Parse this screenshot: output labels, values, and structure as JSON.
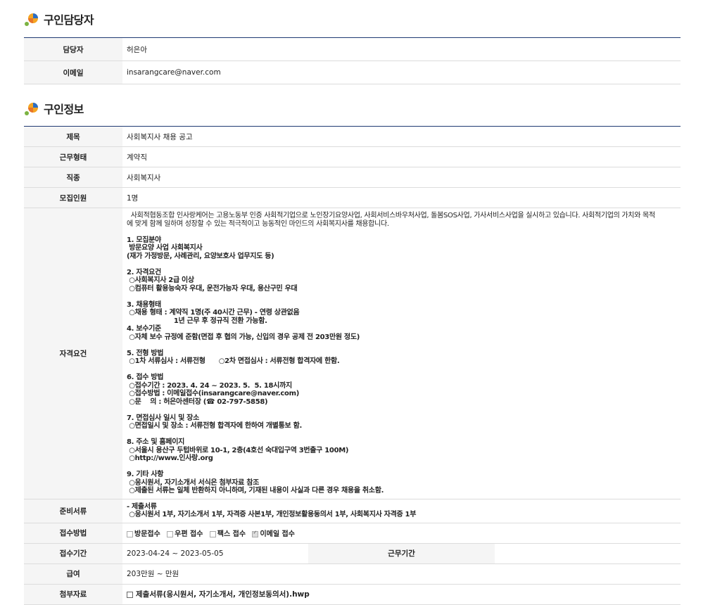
{
  "contact_section": {
    "title": "구인담당자",
    "rows": [
      {
        "label": "담당자",
        "value": "허은아"
      },
      {
        "label": "이메일",
        "value": "insarangcare@naver.com"
      }
    ]
  },
  "job_section": {
    "title": "구인정보",
    "title_row": {
      "label": "제목",
      "value": "사회복지사 채용 공고"
    },
    "type_row": {
      "label": "근무형태",
      "value": "계약직"
    },
    "occupation_row": {
      "label": "직종",
      "value": "사회복지사"
    },
    "headcount_row": {
      "label": "모집인원",
      "value": "1명"
    },
    "qualification_row": {
      "label": "자격요건",
      "intro": "  사회적협동조합 인사랑케어는 고용노동부 인증 사회적기업으로 노인장기요양사업, 사회서비스바우처사업, 돌봄SOS사업, 가사서비스사업을 실시하고 있습니다. 사회적기업의 가치와 목적\n에 맞게 함께 일하며 성장할 수 있는 적극적이고 능동적인 마인드의 사회복지사를 채용합니다.",
      "body": "1. 모집분야\n 방문요양 사업 사회복지사\n(재가 가정방문, 사례관리, 요양보호사 업무지도 등)\n\n2. 자격요건\n ○사회복지사 2급 이상\n ○컴퓨터 활용능숙자 우대, 운전가능자 우대, 용산구민 우대\n\n3. 채용형태\n ○채용 형태 : 계약직 1명(주 40시간 근무) - 연령 상관없음\n                     1년 근무 후 정규직 전환 가능함.\n4. 보수기준\n ○자체 보수 규정에 준함(면접 후 협의 가능, 신입의 경우 공제 전 203만원 정도)\n\n5. 전형 방법\n ○1차 서류심사 : 서류전형      ○2차 면접심사 : 서류전형 합격자에 한함.\n\n6. 접수 방법\n ○접수기간 : 2023. 4. 24 ~ 2023. 5.  5. 18시까지\n ○접수방법 : 이메일접수(insarangcare@naver.com)\n ○문    의 : 허은아센터장 (☎ 02-797-5858)\n\n7. 면접심사 일시 및 장소\n ○면접일시 및 장소 : 서류전형 합격자에 한하여 개별통보 함.\n\n8. 주소 및 홈페이지\n ○서울시 용산구 두텁바위로 10-1, 2층(4호선 숙대입구역 3번출구 100M)\n ○http://www.인사랑.org\n\n9. 기타 사항\n ○응시원서, 자기소개서 서식은 첨부자료 참조\n ○제출된 서류는 일체 반환하지 아니하며, 기재된 내용이 사실과 다른 경우 채용을 취소함."
    },
    "documents_row": {
      "label": "준비서류",
      "value": "- 제출서류\n ○응시원서 1부, 자기소개서 1부, 자격증 사본1부, 개인정보활용동의서 1부, 사회복지사 자격증 1부"
    },
    "method_row": {
      "label": "접수방법",
      "options": [
        {
          "label": "방문접수",
          "checked": false
        },
        {
          "label": "우편 접수",
          "checked": false
        },
        {
          "label": "팩스 접수",
          "checked": false
        },
        {
          "label": "이메일 접수",
          "checked": true
        }
      ]
    },
    "period_row": {
      "label": "접수기간",
      "value": "2023-04-24 ~ 2023-05-05",
      "label2": "근무기간",
      "value2": ""
    },
    "salary_row": {
      "label": "급여",
      "value": "203만원 ~ 만원"
    },
    "attachment_row": {
      "label": "첨부자료",
      "value": "제출서류(응시원서, 자기소개서, 개인정보동의서).hwp"
    }
  },
  "colors": {
    "accent": "#1f3a72",
    "header_bg": "#f5f5f5",
    "border": "#dcdcdc"
  }
}
